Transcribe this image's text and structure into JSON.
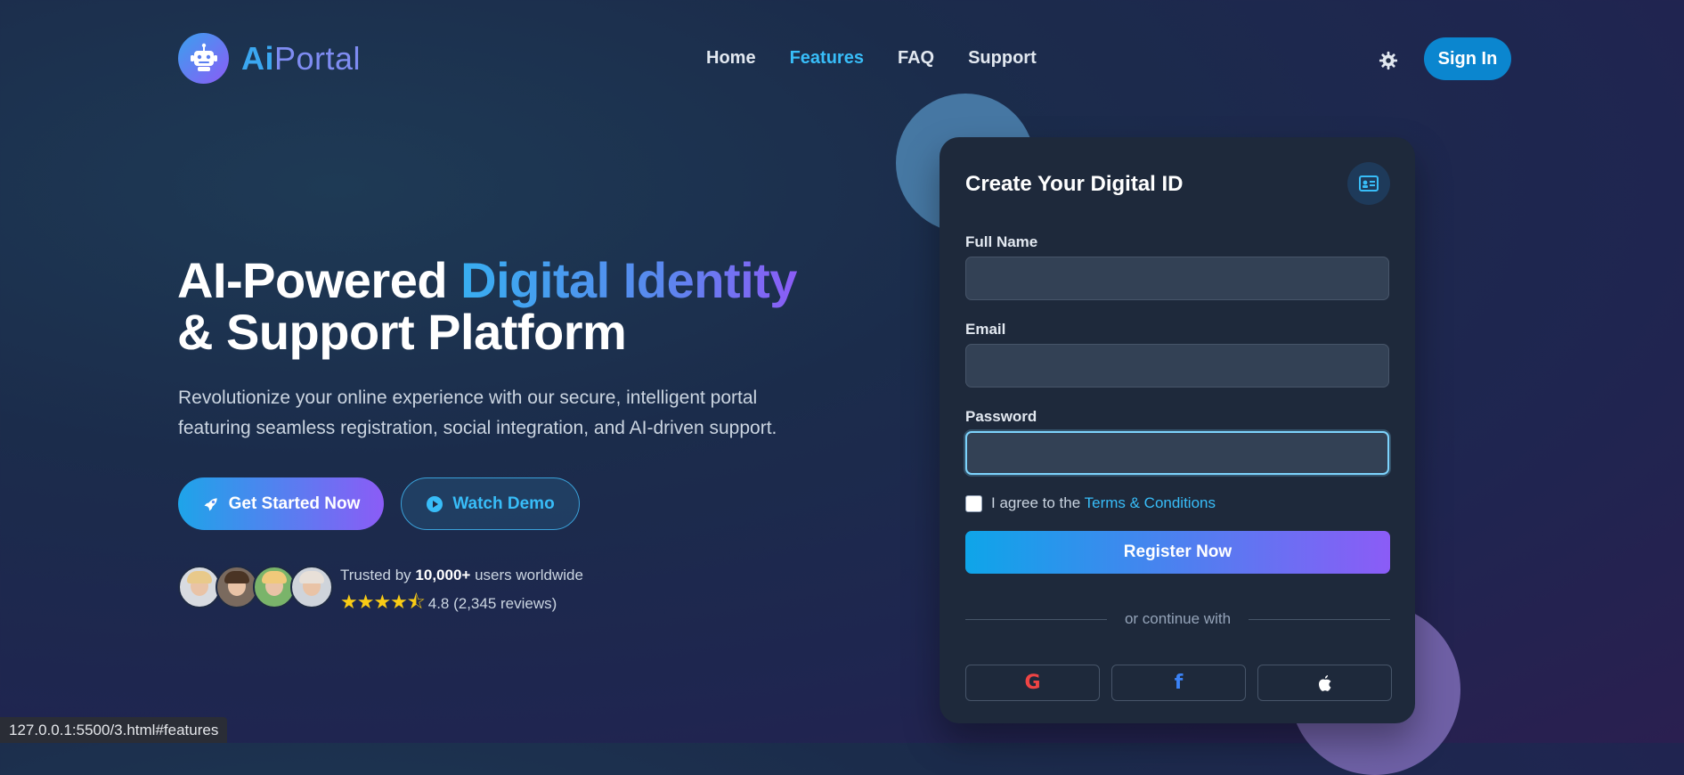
{
  "nav": {
    "logo_ai": "Ai",
    "logo_portal": "Portal",
    "links": [
      {
        "label": "Home",
        "active": false
      },
      {
        "label": "Features",
        "active": true
      },
      {
        "label": "FAQ",
        "active": false
      },
      {
        "label": "Support",
        "active": false
      }
    ],
    "theme_icon": "gear-icon",
    "sign_in": "Sign In"
  },
  "hero": {
    "title_plain_1": "AI-Powered ",
    "title_gradient": "Digital Identity",
    "title_plain_2": "& Support Platform",
    "subtitle_line1": "Revolutionize your online experience with our secure, intelligent portal",
    "subtitle_line2": "featuring seamless registration, social integration, and AI-driven support.",
    "cta_primary": "Get Started Now",
    "cta_secondary": "Watch Demo",
    "trust_prefix": "Trusted by ",
    "trust_count": "10,000+",
    "trust_suffix": " users worldwide",
    "stars": "★★★★⯪",
    "rating": "4.8 (2,345 reviews)",
    "avatars": [
      {
        "name": "avatar-1",
        "hair": "#e8c98a",
        "bg": "#d8dbe0"
      },
      {
        "name": "avatar-2",
        "hair": "#4a3424",
        "bg": "#7a6a5e"
      },
      {
        "name": "avatar-3",
        "hair": "#f0c97a",
        "bg": "#7ab46a"
      },
      {
        "name": "avatar-4",
        "hair": "#e8e0d8",
        "bg": "#cfd4db"
      }
    ]
  },
  "form": {
    "title": "Create Your Digital ID",
    "fields": [
      {
        "label": "Full Name",
        "value": "",
        "placeholder": ""
      },
      {
        "label": "Email",
        "value": "",
        "placeholder": ""
      },
      {
        "label": "Password",
        "value": "",
        "placeholder": ""
      }
    ],
    "agree_prefix": "I agree to the ",
    "agree_link": "Terms & Conditions",
    "submit": "Register Now",
    "divider": "or continue with",
    "social": [
      {
        "icon": "google-icon",
        "glyph": "G",
        "color": "#ef4444"
      },
      {
        "icon": "facebook-icon",
        "glyph": "f",
        "color": "#3b82f6"
      },
      {
        "icon": "apple-icon",
        "glyph": "",
        "color": "#ffffff"
      }
    ]
  },
  "status_url": "127.0.0.1:5500/3.html#features",
  "colors": {
    "accent": "#38bdf8",
    "gradient_start": "#0ea5e9",
    "gradient_end": "#8b5cf6"
  }
}
